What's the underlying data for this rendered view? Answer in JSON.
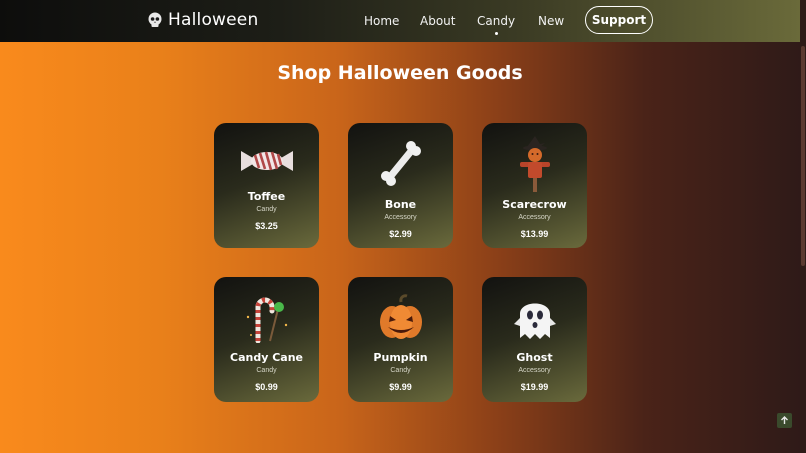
{
  "header": {
    "logo_text": "Halloween",
    "nav": [
      {
        "label": "Home",
        "active": false
      },
      {
        "label": "About",
        "active": false
      },
      {
        "label": "Candy",
        "active": true
      },
      {
        "label": "New",
        "active": false
      }
    ],
    "support_label": "Support"
  },
  "main": {
    "title": "Shop Halloween Goods",
    "products": [
      {
        "name": "Toffee",
        "category": "Candy",
        "price": "$3.25",
        "icon": "toffee-icon"
      },
      {
        "name": "Bone",
        "category": "Accessory",
        "price": "$2.99",
        "icon": "bone-icon"
      },
      {
        "name": "Scarecrow",
        "category": "Accessory",
        "price": "$13.99",
        "icon": "scarecrow-icon"
      },
      {
        "name": "Candy Cane",
        "category": "Candy",
        "price": "$0.99",
        "icon": "candy-cane-icon"
      },
      {
        "name": "Pumpkin",
        "category": "Candy",
        "price": "$9.99",
        "icon": "pumpkin-icon"
      },
      {
        "name": "Ghost",
        "category": "Accessory",
        "price": "$19.99",
        "icon": "ghost-icon"
      }
    ]
  },
  "colors": {
    "accent_orange": "#f98a1c",
    "card_dark": "#121210",
    "card_olive": "#6a6a3c"
  }
}
